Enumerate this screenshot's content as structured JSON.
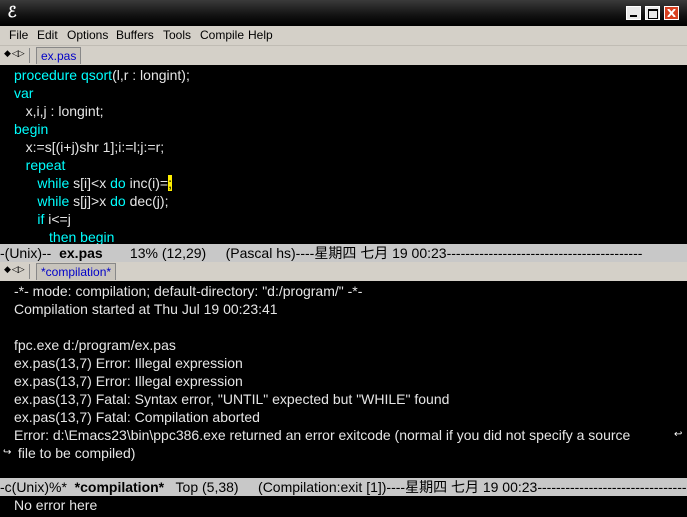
{
  "window": {
    "title_icon": "emacs-icon",
    "buttons": [
      "minimize",
      "maximize",
      "close"
    ]
  },
  "menubar": {
    "items": [
      "File",
      "Edit",
      "Options",
      "Buffers",
      "Tools",
      "Compile",
      "Help"
    ]
  },
  "top_pane": {
    "tab_label": "ex.pas",
    "code": [
      {
        "segments": [
          {
            "t": "procedure",
            "kw": true
          },
          {
            "t": " "
          },
          {
            "t": "qsort",
            "kw": true
          },
          {
            "t": "(l,r : longint);"
          }
        ]
      },
      {
        "segments": [
          {
            "t": "var",
            "kw": true
          }
        ]
      },
      {
        "segments": [
          {
            "t": "   x,i,j : longint;"
          }
        ]
      },
      {
        "segments": [
          {
            "t": "begin",
            "kw": true
          }
        ]
      },
      {
        "segments": [
          {
            "t": "   x:=s[(i+j)shr 1];i:=l;j:=r;"
          }
        ]
      },
      {
        "segments": [
          {
            "t": "   "
          },
          {
            "t": "repeat",
            "kw": true
          }
        ]
      },
      {
        "segments": [
          {
            "t": "      "
          },
          {
            "t": "while",
            "kw": true
          },
          {
            "t": " s[i]<x "
          },
          {
            "t": "do",
            "kw": true
          },
          {
            "t": " inc(i)="
          },
          {
            "t": ";",
            "cursor": true
          }
        ]
      },
      {
        "segments": [
          {
            "t": "      "
          },
          {
            "t": "while",
            "kw": true
          },
          {
            "t": " s[j]>x "
          },
          {
            "t": "do",
            "kw": true
          },
          {
            "t": " dec(j);"
          }
        ]
      },
      {
        "segments": [
          {
            "t": "      "
          },
          {
            "t": "if",
            "kw": true
          },
          {
            "t": " i<=j"
          }
        ]
      },
      {
        "segments": [
          {
            "t": "         "
          },
          {
            "t": "then begin",
            "kw": true
          }
        ]
      }
    ],
    "modeline": {
      "prefix": "-(Unix)--  ",
      "buffer": "ex.pas",
      "rest": "       13% (12,29)     (Pascal hs)----星期四 七月 19 00:23------------------------------------------"
    }
  },
  "bottom_pane": {
    "tab_label": "*compilation*",
    "lines": [
      "-*- mode: compilation; default-directory: \"d:/program/\" -*-",
      "Compilation started at Thu Jul 19 00:23:41",
      "",
      "fpc.exe d:/program/ex.pas",
      "ex.pas(13,7) Error: Illegal expression",
      "ex.pas(13,7) Error: Illegal expression",
      "ex.pas(13,7) Fatal: Syntax error, \"UNTIL\" expected but \"WHILE\" found",
      "ex.pas(13,7) Fatal: Compilation aborted",
      "Error: d:\\Emacs23\\bin\\ppc386.exe returned an error exitcode (normal if you did not specify a source",
      " file to be compiled)"
    ],
    "modeline": {
      "prefix": "-c(Unix)%*  ",
      "buffer": "*compilation*",
      "rest": "   Top (5,38)     (Compilation:exit [1])----星期四 七月 19 00:23------------------------------------------"
    }
  },
  "echo_area": {
    "text": "No error here"
  },
  "colors": {
    "keyword": "#00ffff",
    "background": "#000000",
    "text": "#e6e6e6",
    "cursor": "#fff000"
  }
}
